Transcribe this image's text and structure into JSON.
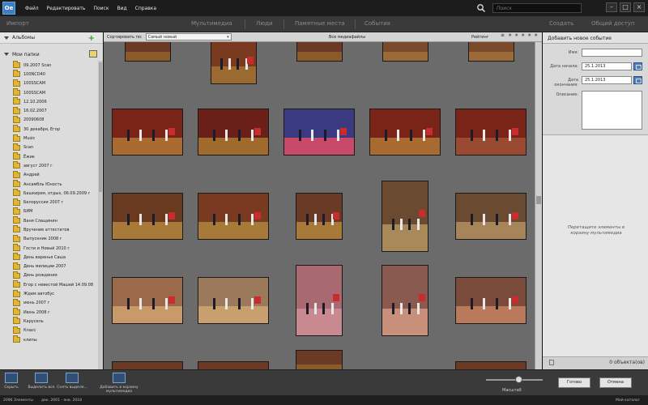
{
  "app": {
    "logo_text": "Oe"
  },
  "menu": {
    "items": [
      "Файл",
      "Редактировать",
      "Поиск",
      "Вид",
      "Справка"
    ]
  },
  "search": {
    "placeholder": "Поиск"
  },
  "window_controls": {
    "minimize": "–",
    "maximize": "□",
    "close": "×"
  },
  "tabs": {
    "import": "Импорт",
    "media": "Мультимедиа",
    "people": "Люди",
    "places": "Памятные места",
    "events": "События",
    "create": "Создать",
    "share": "Общий доступ"
  },
  "sidebar": {
    "albums_label": "Альбомы",
    "folders_label": "Мои папки",
    "folders": [
      "09.2007 Scan",
      "100NCD40",
      "100SSCAM",
      "100SSCAM",
      "12.10.2006",
      "16.02.2007",
      "20090608",
      "30 декабря, Егор",
      "Music",
      "Scan",
      "Ёжик",
      "август 2007 г",
      "Андрей",
      "Ансамбль Юность",
      "Башкирия, отдых, 06.09.2009 г",
      "Белоруссия 2007 г",
      "БИМ",
      "Ваня Слащинин",
      "Вручение аттестатов",
      "Выпускник 2008 г",
      "Гости и Новый 2010 г",
      "День варенья Саша",
      "День милиции 2007",
      "День рождения",
      "Егор с невестой Машей 14.09.08",
      "Ждем автобус",
      "июнь 2007 г",
      "Июнь 2008 г",
      "Карусель",
      "Класс",
      "клипы"
    ]
  },
  "grid_toolbar": {
    "sort_label": "Сортировать по:",
    "sort_value": "Самый новый",
    "all_media": "Все медиафайлы",
    "rating_label": "Рейтинг",
    "rating_op": "≥",
    "stars": [
      "★",
      "★",
      "★",
      "★",
      "★"
    ]
  },
  "right_panel": {
    "title": "Добавить новое событие",
    "name_label": "Имя:",
    "name_value": "",
    "start_label": "Дата начала:",
    "start_value": "25.1.2013",
    "end_label": "Дата окончания:",
    "end_value": "25.1.2013",
    "desc_label": "Описание:",
    "drop_hint": "Перетащите элементы в корзину мультимедиа",
    "count": "0 объекта(ов)"
  },
  "bottom": {
    "tools": [
      "Скрыть",
      "Выделить все",
      "Снять выделе...",
      "Добавить в корзину мультимедиа"
    ],
    "zoom_label": "Масштаб",
    "done": "Готово",
    "cancel": "Отмена"
  },
  "status": {
    "items": "2096 Элементы",
    "range": "дек. 2001 - янв. 2018",
    "catalog": "Мой каталог"
  },
  "colors": {
    "menubar_bg": "#1c1c1c",
    "tabbar_bg": "#3a3a3a",
    "sidebar_bg": "#dcdcdc",
    "grid_bg": "#6b6b6b",
    "accent": "#3d7fc4"
  }
}
